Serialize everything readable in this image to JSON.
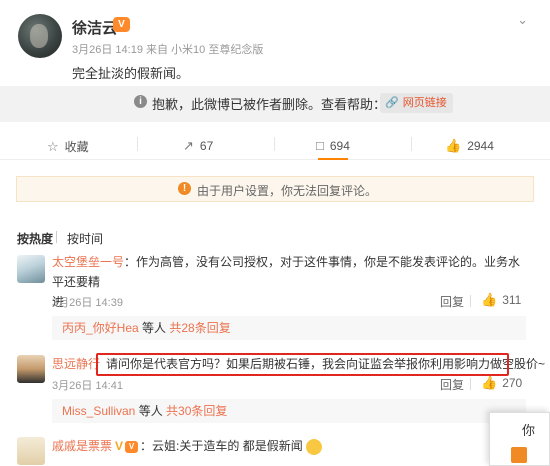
{
  "post": {
    "author": "徐洁云",
    "meta": "3月26日 14:19 来自 小米10 至尊纪念版",
    "text": "完全扯淡的假新闻。",
    "deleted_notice": "抱歉，此微博已被作者删除。查看帮助：",
    "help_link": "网页链接"
  },
  "actions": {
    "favorite": "收藏",
    "repost_count": "67",
    "comment_count": "694",
    "like_count": "2944"
  },
  "notice": "由于用户设置，你无法回复评论。",
  "sort": {
    "hot": "按热度",
    "time": "按时间"
  },
  "comments": [
    {
      "user": "太空堡垒一号",
      "text_line1": "：作为高管，没有公司授权，对于这件事情，你是不能发表评论的。业务水平还要精",
      "text_line2": "进",
      "time": "3月26日 14:39",
      "reply": "回复",
      "likes": "311",
      "sub_user": "丙丙_你好Hea",
      "sub_mid": " 等人 ",
      "sub_count": "共28条回复"
    },
    {
      "user": "思远静行",
      "text": "请问你是代表官方吗？如果后期被石锤，我会向证监会举报你利用影响力做空股价~",
      "time": "3月26日 14:41",
      "reply": "回复",
      "likes": "270",
      "sub_user": "Miss_Sullivan",
      "sub_mid": " 等人 ",
      "sub_count": "共30条回复"
    },
    {
      "user": "戚戚是票票",
      "text": "：云姐:关于造车的 都是假新闻"
    }
  ],
  "popup": {
    "text": "你"
  },
  "colors": {
    "accent": "#ff8200",
    "username": "#eb7350",
    "highlight": "#e0261f"
  }
}
